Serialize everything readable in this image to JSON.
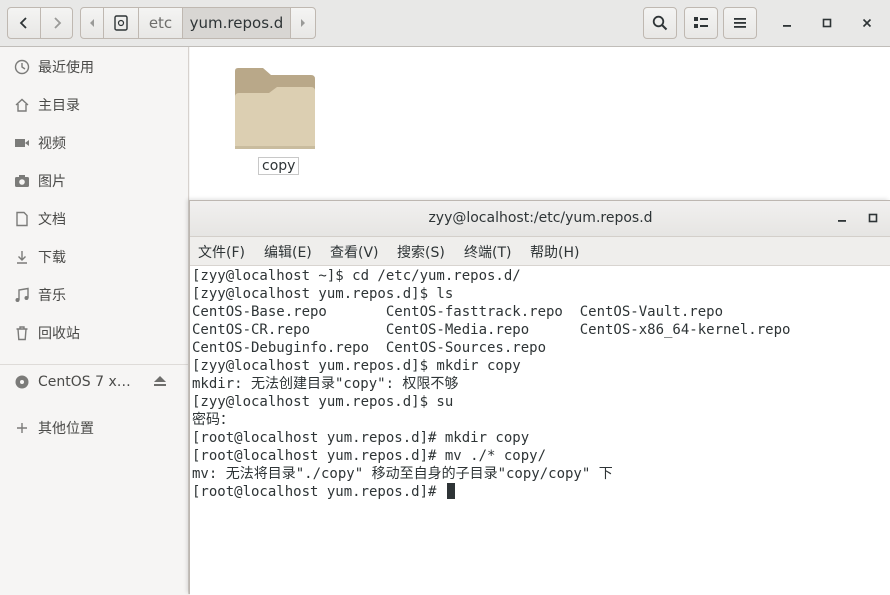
{
  "header": {
    "breadcrumb_parent": "etc",
    "breadcrumb_current": "yum.repos.d"
  },
  "icons": {
    "back": "chevron-left-icon",
    "forward": "chevron-right-icon",
    "search": "search-icon",
    "view": "list-view-icon",
    "menu": "hamburger-menu-icon",
    "minimize": "minimize-icon",
    "maximize": "maximize-icon",
    "close": "close-icon"
  },
  "sidebar": {
    "items": [
      {
        "label": "最近使用",
        "icon": "clock-icon"
      },
      {
        "label": "主目录",
        "icon": "home-icon"
      },
      {
        "label": "视频",
        "icon": "video-icon"
      },
      {
        "label": "图片",
        "icon": "camera-icon"
      },
      {
        "label": "文档",
        "icon": "document-icon"
      },
      {
        "label": "下载",
        "icon": "download-icon"
      },
      {
        "label": "音乐",
        "icon": "music-icon"
      },
      {
        "label": "回收站",
        "icon": "trash-icon"
      },
      {
        "label": "CentOS 7 x…",
        "icon": "disc-icon"
      },
      {
        "label": "其他位置",
        "icon": "plus-icon"
      }
    ]
  },
  "content": {
    "files": [
      {
        "name": "copy",
        "type": "folder"
      }
    ]
  },
  "terminal": {
    "title": "zyy@localhost:/etc/yum.repos.d",
    "menu": [
      "文件(F)",
      "编辑(E)",
      "查看(V)",
      "搜索(S)",
      "终端(T)",
      "帮助(H)"
    ],
    "lines": [
      "[zyy@localhost ~]$ cd /etc/yum.repos.d/",
      "[zyy@localhost yum.repos.d]$ ls",
      "CentOS-Base.repo       CentOS-fasttrack.repo  CentOS-Vault.repo",
      "CentOS-CR.repo         CentOS-Media.repo      CentOS-x86_64-kernel.repo",
      "CentOS-Debuginfo.repo  CentOS-Sources.repo",
      "[zyy@localhost yum.repos.d]$ mkdir copy",
      "mkdir: 无法创建目录\"copy\": 权限不够",
      "[zyy@localhost yum.repos.d]$ su",
      "密码：",
      "[root@localhost yum.repos.d]# mkdir copy",
      "[root@localhost yum.repos.d]# mv ./* copy/",
      "mv: 无法将目录\"./copy\" 移动至自身的子目录\"copy/copy\" 下",
      "[root@localhost yum.repos.d]# "
    ]
  },
  "colors": {
    "folder": "#d8c9a8",
    "folder_tab": "#b9a889",
    "background": "#f6f5f4",
    "terminal_text": "#2e3436"
  }
}
